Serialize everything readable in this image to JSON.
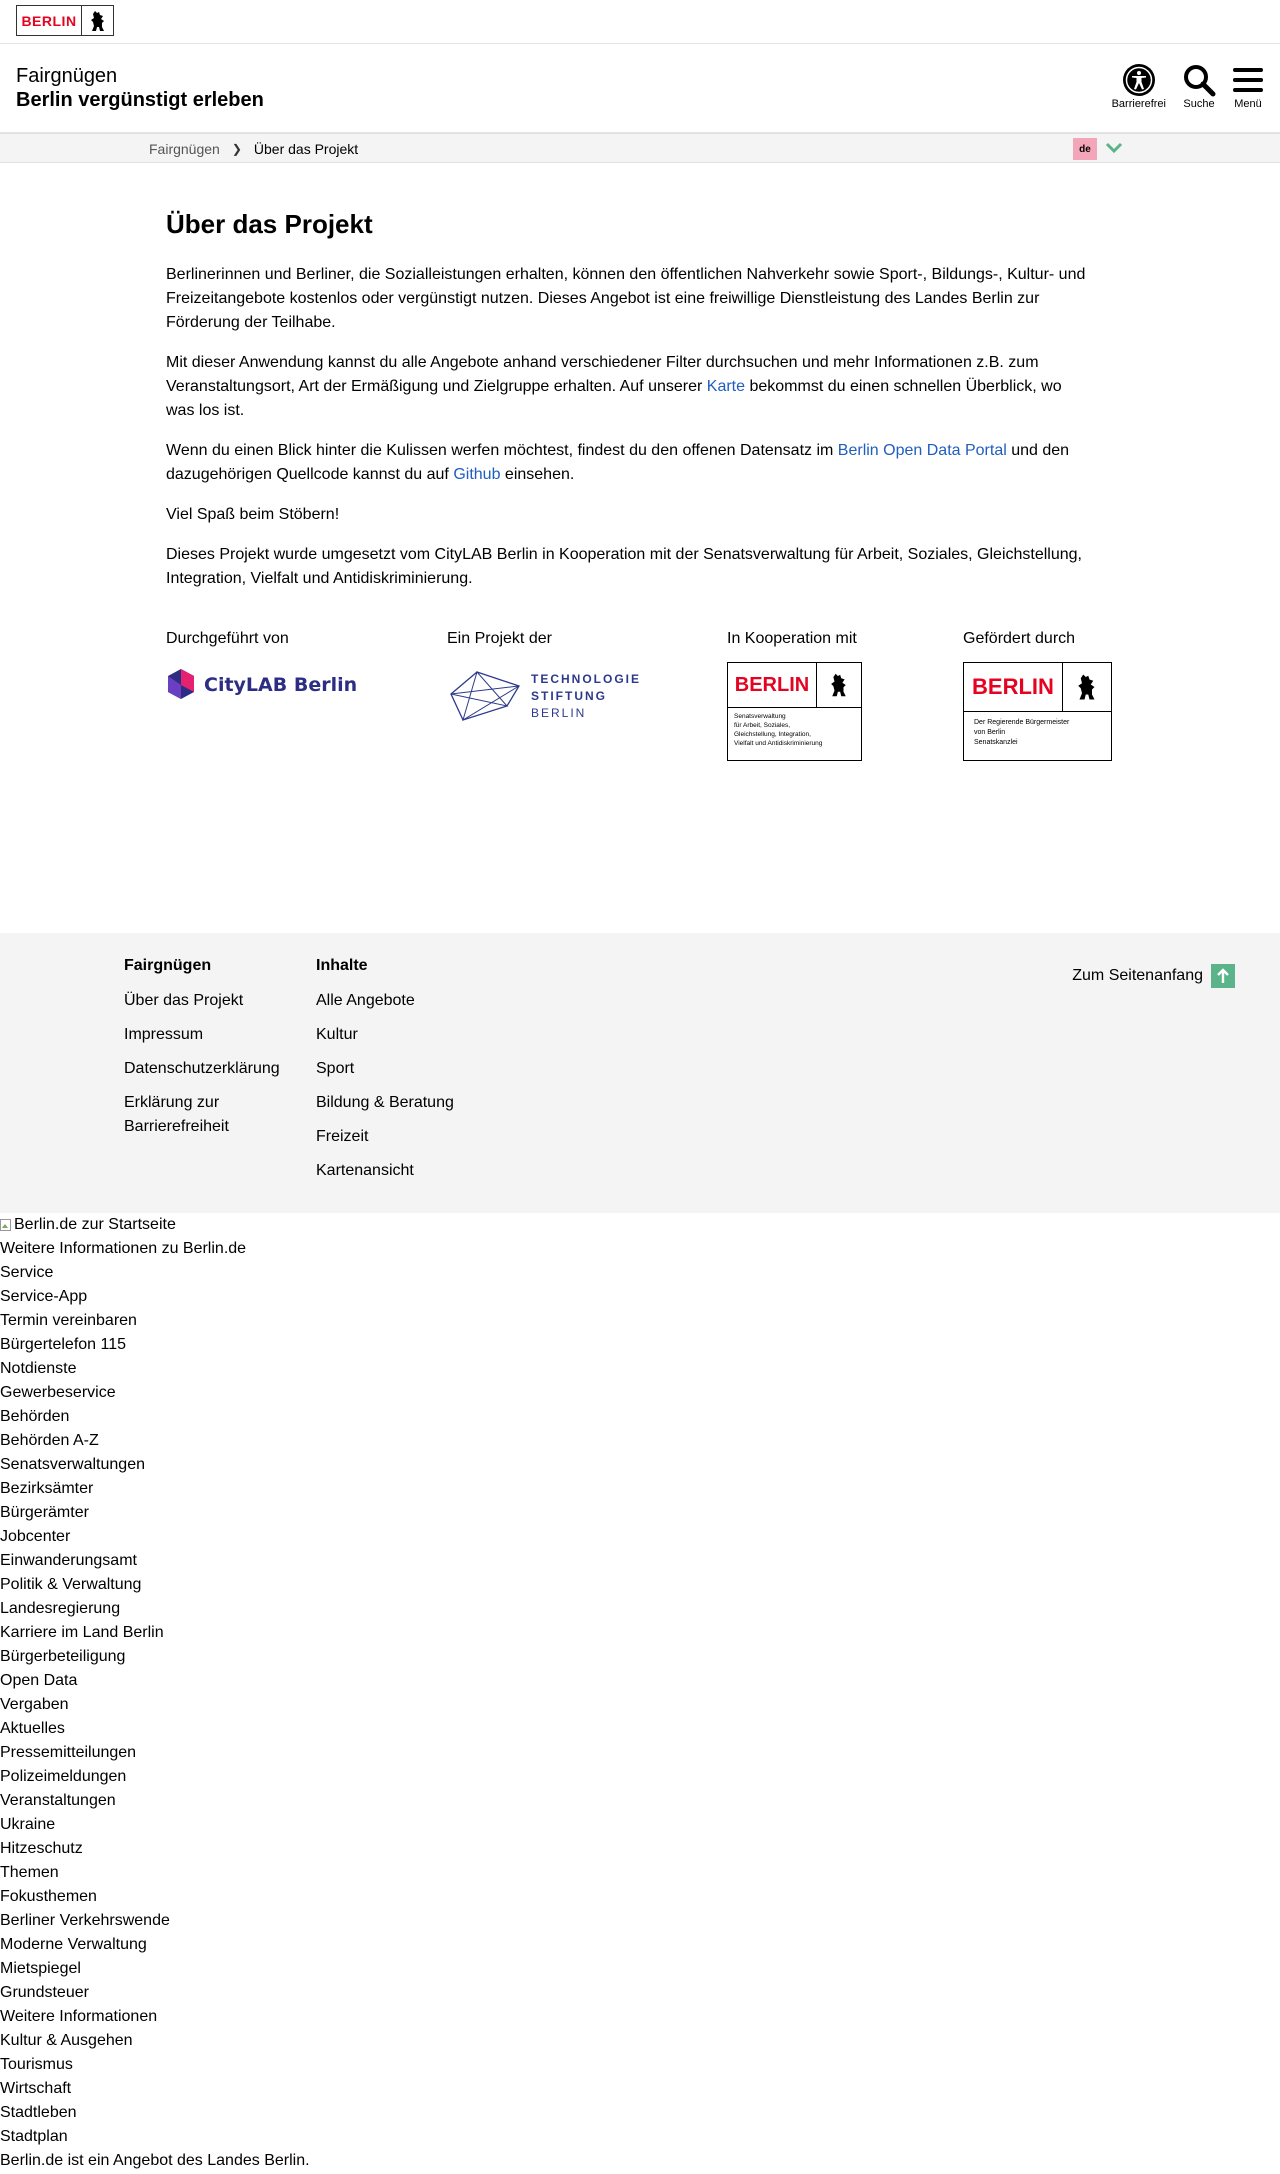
{
  "logo": {
    "text": "BERLIN"
  },
  "header": {
    "site_name": "Fairgnügen",
    "tagline": "Berlin vergünstigt erleben",
    "tools": [
      {
        "label": "Barrierefrei",
        "icon": "accessibility-icon"
      },
      {
        "label": "Suche",
        "icon": "search-icon"
      },
      {
        "label": "Menü",
        "icon": "menu-icon"
      }
    ]
  },
  "breadcrumb": {
    "home": "Fairgnügen",
    "current": "Über das Projekt"
  },
  "language": {
    "code": "de"
  },
  "main": {
    "title": "Über das Projekt",
    "p1": "Berlinerinnen und Berliner, die Sozialleistungen erhalten, können den öffentlichen Nahverkehr sowie Sport-, Bildungs-, Kultur- und Freizeitangebote kostenlos oder vergünstigt nutzen. Dieses Angebot ist eine freiwillige Dienstleistung des Landes Berlin zur Förderung der Teilhabe.",
    "p2_before": "Mit dieser Anwendung kannst du alle Angebote anhand verschiedener Filter durchsuchen und mehr Informationen z.B. zum Veranstaltungsort, Art der Ermäßigung und Zielgruppe erhalten. Auf unserer ",
    "p2_link": "Karte",
    "p2_after": " bekommst du einen schnellen Überblick, wo was los ist.",
    "p3_before": "Wenn du einen Blick hinter die Kulissen werfen möchtest, findest du den offenen Datensatz im ",
    "p3_link1": "Berlin Open Data Portal",
    "p3_middle": " und den dazugehörigen Quellcode kannst du auf ",
    "p3_link2": "Github",
    "p3_after": " einsehen.",
    "p4": "Viel Spaß beim Stöbern!",
    "p5": "Dieses Projekt wurde umgesetzt vom CityLAB Berlin in Kooperation mit der Senatsverwaltung für Arbeit, Soziales, Gleichstellung, Integration, Vielfalt und Antidiskriminierung."
  },
  "partners": [
    {
      "label": "Durchgeführt von",
      "logo_text": "CityLAB Berlin"
    },
    {
      "label": "Ein Projekt der",
      "logo_lines": [
        "TECHNOLOGIE",
        "STIFTUNG",
        "BERLIN"
      ]
    },
    {
      "label": "In Kooperation mit",
      "logo_word": "BERLIN",
      "logo_sub": [
        "Senatsverwaltung",
        "für Arbeit, Soziales,",
        "Gleichstellung, Integration,",
        "Vielfalt und Antidiskriminierung"
      ]
    },
    {
      "label": "Gefördert durch",
      "logo_word": "BERLIN",
      "logo_sub": [
        "Der Regierende Bürgermeister",
        "von Berlin",
        "Senatskanzlei"
      ]
    }
  ],
  "footer": {
    "col1": {
      "heading": "Fairgnügen",
      "links": [
        "Über das Projekt",
        "Impressum",
        "Datenschutzerklärung",
        "Erklärung zur Barrierefreiheit"
      ]
    },
    "col2": {
      "heading": "Inhalte",
      "links": [
        "Alle Angebote",
        "Kultur",
        "Sport",
        "Bildung & Beratung",
        "Freizeit",
        "Kartenansicht"
      ]
    },
    "to_top": "Zum Seitenanfang"
  },
  "lower_list": [
    "Berlin.de zur Startseite",
    "Weitere Informationen zu Berlin.de",
    "Service",
    "Service-App",
    "Termin vereinbaren",
    "Bürgertelefon 115",
    "Notdienste",
    "Gewerbeservice",
    "Behörden",
    "Behörden A-Z",
    "Senatsverwaltungen",
    "Bezirksämter",
    "Bürgerämter",
    "Jobcenter",
    "Einwanderungsamt",
    "Politik & Verwaltung",
    "Landesregierung",
    "Karriere im Land Berlin",
    "Bürgerbeteiligung",
    "Open Data",
    "Vergaben",
    "Aktuelles",
    "Pressemitteilungen",
    "Polizeimeldungen",
    "Veranstaltungen",
    "Ukraine",
    "Hitzeschutz",
    "Themen",
    "Fokusthemen",
    "Berliner Verkehrswende",
    "Moderne Verwaltung",
    "Mietspiegel",
    "Grundsteuer",
    "Weitere Informationen",
    "Kultur & Ausgehen",
    "Tourismus",
    "Wirtschaft",
    "Stadtleben",
    "Stadtplan",
    "Berlin.de ist ein Angebot des Landes Berlin."
  ],
  "colors": {
    "link": "#1f5dbf",
    "berlin_red": "#e40422",
    "lang_badge": "#f2a6b8",
    "to_top": "#5bb38a",
    "citylab": "#2d2e83"
  }
}
